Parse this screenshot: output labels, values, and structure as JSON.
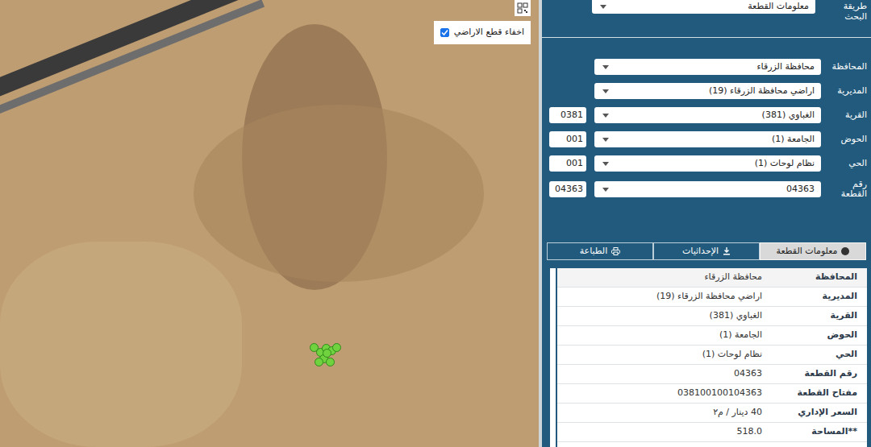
{
  "search": {
    "label": "طريقة البحث",
    "method": "معلومات القطعة"
  },
  "map": {
    "hide_parcels": {
      "label": "اخفاء قطع الاراضي",
      "checked": true
    }
  },
  "form": [
    {
      "label": "المحافظة",
      "value": "محافظة الزرقاء"
    },
    {
      "label": "المديرية",
      "value": "اراضي محافظة الزرقاء (19)"
    },
    {
      "label": "القرية",
      "value": "الغباوي (381)",
      "code": "0381"
    },
    {
      "label": "الحوض",
      "value": "الجامعة (1)",
      "code": "001"
    },
    {
      "label": "الحي",
      "value": "نظام لوحات (1)",
      "code": "001"
    },
    {
      "label": "رقم القطعة",
      "value": "04363",
      "code": "04363"
    }
  ],
  "tabs": [
    {
      "label": "معلومات القطعة",
      "selected": true,
      "kind": "info"
    },
    {
      "label": "الإحداثيات",
      "selected": false,
      "kind": "coords"
    },
    {
      "label": "الطباعة",
      "selected": false,
      "kind": "print"
    }
  ],
  "info": [
    {
      "label": "المحافظة",
      "value": "محافظة الزرقاء"
    },
    {
      "label": "المديرية",
      "value": "اراضي محافظة الزرقاء (19)"
    },
    {
      "label": "القرية",
      "value": "الغباوي (381)"
    },
    {
      "label": "الحوض",
      "value": "الجامعة (1)"
    },
    {
      "label": "الحي",
      "value": "نظام لوحات (1)"
    },
    {
      "label": "رقم القطعة",
      "value": "04363"
    },
    {
      "label": "مفتاح القطعة",
      "value": "038100100104363"
    },
    {
      "label": "السعر الإداري",
      "value": "40 دينار / م٢"
    },
    {
      "label": "**المساحة",
      "value": "518.0"
    }
  ]
}
